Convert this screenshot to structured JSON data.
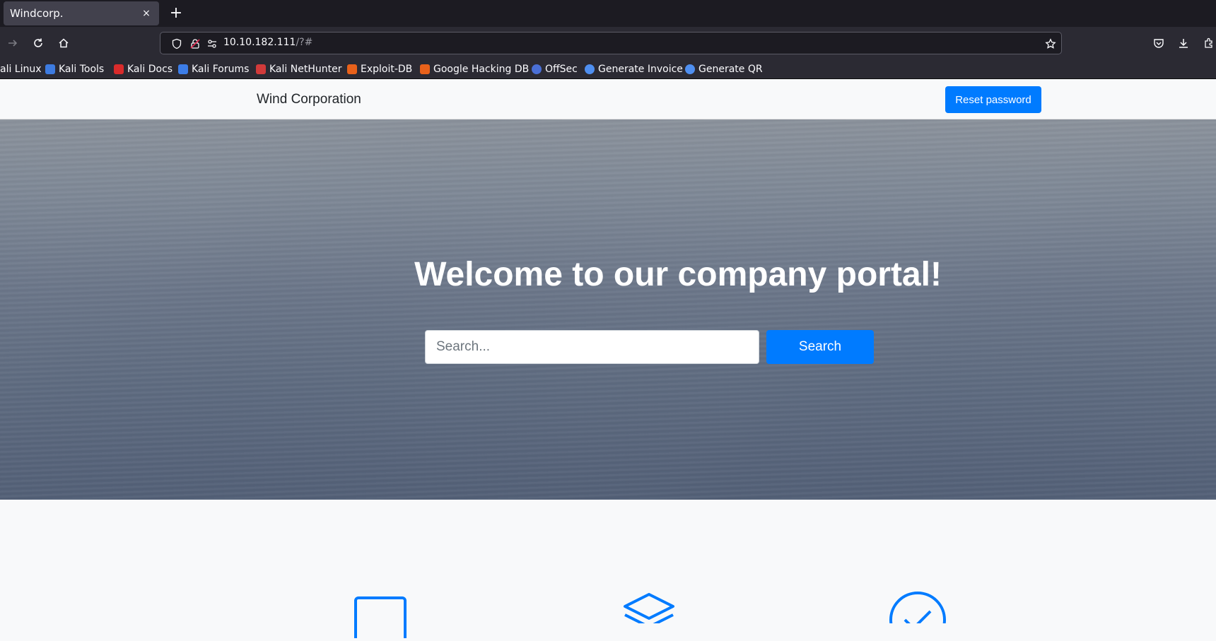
{
  "browser": {
    "tab_title": "Windcorp.",
    "tab_close": "×",
    "new_tab": "+",
    "url_host": "10.10.182.111",
    "url_path": "/?#",
    "bookmarks": [
      {
        "label": "ali Linux",
        "color": "#367bf0"
      },
      {
        "label": "Kali Tools",
        "color": "#3d7be0"
      },
      {
        "label": "Kali Docs",
        "color": "#d92b2b"
      },
      {
        "label": "Kali Forums",
        "color": "#3c7de8"
      },
      {
        "label": "Kali NetHunter",
        "color": "#d13a3a"
      },
      {
        "label": "Exploit-DB",
        "color": "#e8611a"
      },
      {
        "label": "Google Hacking DB",
        "color": "#e8611a"
      },
      {
        "label": "OffSec",
        "color": "#4a6fd6"
      },
      {
        "label": "Generate Invoice",
        "color": "#4f8ff0"
      },
      {
        "label": "Generate QR",
        "color": "#4f8ff0"
      }
    ]
  },
  "site": {
    "brand": "Wind Corporation",
    "reset_label": "Reset password",
    "hero_title": "Welcome to our company portal!",
    "search_placeholder": "Search...",
    "search_label": "Search",
    "accent_color": "#007bff",
    "feature_icons": [
      "square-icon",
      "layers-icon",
      "check-circle-icon"
    ]
  }
}
